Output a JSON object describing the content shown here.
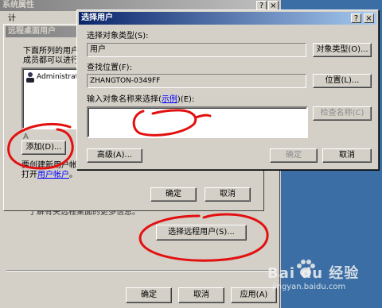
{
  "sys_props": {
    "title": "系统属性",
    "tab_visible": "计"
  },
  "rdp_dialog": {
    "title": "远程桌面用户",
    "desc_line1": "下面所列的用户",
    "desc_line2": "成员都可以进行",
    "user_item": "Administrat",
    "list_footer": "A",
    "add_button": "添加(D)...",
    "info_line1": "要创建新用户帐",
    "info_prefix": "打开",
    "info_link": "用户帐户",
    "info_suffix": "。",
    "ok_button": "确定",
    "cancel_button": "取消"
  },
  "remote_section": {
    "more_info": "了解有关远程桌面的更多信息。",
    "select_remote_users_button": "选择远程用户(S)..."
  },
  "bottom_buttons": {
    "ok": "确定",
    "cancel": "取消",
    "apply": "应用(A)"
  },
  "select_users": {
    "title": "选择用户",
    "object_type_label": "选择对象类型(S):",
    "object_type_value": "用户",
    "object_types_button": "对象类型(O)...",
    "location_label": "查找位置(F):",
    "location_value": "ZHANGTON-0349FF",
    "location_button": "位置(L)...",
    "names_label_prefix": "输入对象名称来选择(",
    "names_label_link": "示例",
    "names_label_suffix": ")(E):",
    "check_names_button": "检查名称(C)",
    "advanced_button": "高级(A)...",
    "ok_button": "确定",
    "cancel_button": "取消"
  },
  "window_controls": {
    "help": "?",
    "close": "×"
  },
  "watermark": {
    "brand": "Bai du 经验",
    "url": "jingyan.baidu.com"
  }
}
